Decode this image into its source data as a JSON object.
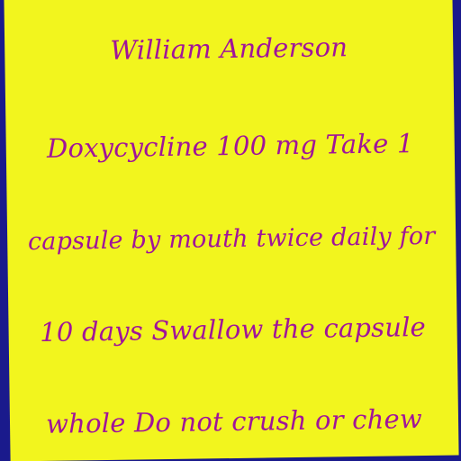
{
  "note": {
    "background_color": "#f2f51e",
    "frame_color": "#1a1a8c",
    "text_color": "#a0149a",
    "lines": [
      "William Anderson",
      "Doxycycline 100 mg Take 1",
      "capsule by mouth twice daily for",
      "10 days Swallow the capsule",
      "whole Do not crush or chew"
    ]
  }
}
